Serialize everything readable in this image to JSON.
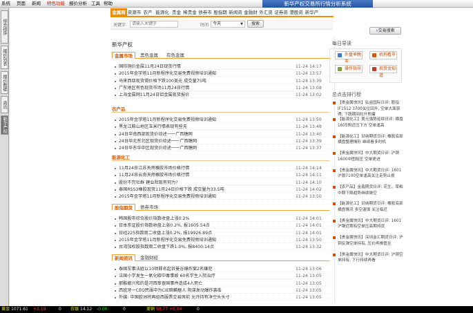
{
  "menu": {
    "items": [
      "系统",
      "页面",
      "新闻",
      "特色功能",
      "报价分析",
      "工具",
      "帮助"
    ],
    "active_index": 3
  },
  "app_title": "新华产权交易所行情分析系统",
  "sidebar": {
    "tabs": [
      "综合排序",
      "报价列表",
      "报价数据",
      "资讯",
      "新华产权"
    ],
    "active_index": 4
  },
  "tabs": [
    "金属商讯",
    "资源市场",
    "农产品",
    "能源化工",
    "贵金属",
    "稀贵金属",
    "债券市场",
    "股指期货",
    "新闻资讯",
    "金融财经",
    "外汇资讯",
    "证券资讯",
    "港股资讯",
    "新华产权"
  ],
  "tabs_active_index": 0,
  "search": {
    "keyword_label": "关键字",
    "keyword_placeholder": "请输入关键字",
    "time_label": "时间",
    "time_value": "今天",
    "search_button": "搜索",
    "trade_search_button": "交易搜索"
  },
  "page_title": "新华产权",
  "sections": [
    {
      "tabs": [
        "金属市场",
        "黑色金属",
        "有色金属"
      ],
      "active": 0,
      "items": [
        {
          "t": "国际铜价金属11月24日现货行情",
          "d": "11-24 14:17"
        },
        {
          "t": "2015年金字塔11月新程序化交易免费视频培训通知",
          "d": "11-24 13:57"
        },
        {
          "t": "马来西亚现货锡价格下跌100美元 成交量75吨",
          "d": "11-24 13:39"
        },
        {
          "t": "广东地区有色现货市场11月24日行情",
          "d": "11-24 13:08"
        },
        {
          "t": "上海金属网11月24日铝金属现货报价",
          "d": "11-24 13:02"
        }
      ]
    },
    {
      "head": "农产品",
      "items": [
        {
          "t": "2015年金字塔11月新程序化交易免费视频培训通知",
          "d": "11-24 13:50"
        },
        {
          "t": "黑龙江鞍山地区玉米行情表现有些无",
          "d": "11-24 13:48"
        },
        {
          "t": "24日华南西部现货价综述一一广西糖网",
          "d": "11-24 13:40"
        },
        {
          "t": "24日华北东北区现货价综述一一广西糖网",
          "d": "11-24 13:39"
        },
        {
          "t": "24日华东华中区现货价综述一一广西糖网",
          "d": "11-24 13:37"
        }
      ]
    },
    {
      "head": "能源化工",
      "items": [
        {
          "t": "11月24日江苏天然橡胶市场价格行情",
          "d": "11-24 14:14"
        },
        {
          "t": "11月24日云南天然橡胶市场价格行情",
          "d": "11-24 14:11"
        },
        {
          "t": "股份不完社群 建业险现有何为?",
          "d": "11-24 14:10"
        },
        {
          "t": "泰国RSS3橡胶现货11月24日价格下跌 成交量为33.5吨",
          "d": "11-24 14:02"
        },
        {
          "t": "2015年金字塔11月新程序化交易免费视频培训通知",
          "d": "11-24 13:50"
        }
      ]
    },
    {
      "tabs": [
        "股指期货",
        "债券市场"
      ],
      "active": 0,
      "items": [
        {
          "t": "韩国股市综合股价指数收盘上涨0.2%",
          "d": "11-24 14:01"
        },
        {
          "t": "日本东证股价指数收盘上涨0.2%, 报1605.54点",
          "d": "11-24 14:01"
        },
        {
          "t": "日经225指数周二收盘上涨0.2%, 报19926.89点",
          "d": "11-24 14:01"
        },
        {
          "t": "2015年金字塔11月新程序化交易免费视频培训通知",
          "d": "11-24 13:50"
        },
        {
          "t": "台湾加权股指数周二收盘下跌1.0%, 报8400.14点",
          "d": "11-24 13:32"
        }
      ]
    },
    {
      "tabs": [
        "新闻资讯",
        "金融财经"
      ],
      "active": 0,
      "items": [
        {
          "t": "泰国军事法庭以10项罪名起诉曼谷爆炸案2名嫌犯",
          "d": "11-24 13:06"
        },
        {
          "t": "法国小学发生一氧化碳中毒事故 60名学生入院治疗",
          "d": "11-24 13:05"
        },
        {
          "t": "那酷撤兴和的是河西审查国事件造成4人死亡",
          "d": "11-24 13:05"
        },
        {
          "t": "西班牙一CEO民服中为CIE暗麟据人 阴谋发动爆炸袭击",
          "d": "11-24 13:05"
        },
        {
          "t": "外媒: 中国欧洲将再组西服票交易席前 允许持有净空头头寸",
          "d": "11-24 13:05"
        }
      ]
    }
  ],
  "right_panel": {
    "title": "每日导读",
    "buttons": [
      {
        "label": "外盘早晚市",
        "color": "#3a7bd5"
      },
      {
        "label": "机构看市",
        "color": "#d85a00"
      },
      {
        "label": "操作指导",
        "color": "#7a9f35"
      },
      {
        "label": "现货金知道",
        "color": "#c23a2a"
      }
    ]
  },
  "rank": {
    "title": "总点击排行榜",
    "items": [
      "【贵金属快讯】弘益国际日评: 股指IF1512 3700关位回升, 空单大面获得; 下跌期间柱升附着",
      "【能源化工】美元强势延续日评: 横盘1605附近压下方 空单逢高",
      "【能源化工】甘纳期货日评: 橡胶底部横盘整理情形 继续看多时机",
      "【贵金属快讯】中大期货日评: 沪铜1600中图阻压 空单更进",
      "【贵金属快讯】中大期货日评: 1601沪银7100空单逢高关注走势止损",
      "【农产品】金鑫期货日评: 花生、菜粕中期下降趋势继续做空",
      "【能源化工】甘纳期货日评: 橡胶底部横盘情况 多空谨慎 关注临近",
      "【贵金属快讯】中大期货日评: 1601沪镍近期有空单压高期持货",
      "【贵金属快讯】深圳金汇期货日评: 沪铜反弹空单持有, 压价再推管至",
      "【贵金属快讯】中大期货日评: 沪铜空单持有; 下行持续再看"
    ]
  },
  "statusbar": [
    {
      "label": "黄金",
      "value": "1071.61",
      "color": "#e0e0e0"
    },
    {
      "label": "",
      "value": "+2.19",
      "color": "#ff3b3b"
    },
    {
      "label": "",
      "value": "0",
      "color": "#e0e0e0"
    },
    {
      "label": "白银",
      "value": "14.12",
      "color": "#e0e0e0"
    },
    {
      "label": "",
      "value": "-0.00",
      "color": "#27d827"
    },
    {
      "label": "",
      "value": "0",
      "color": "#e0e0e0"
    },
    {
      "label": "美铜",
      "value": "98.77",
      "color": "#ff3b3b"
    },
    {
      "label": "",
      "value": "+0.04",
      "color": "#ff3b3b"
    },
    {
      "label": "",
      "value": "0",
      "color": "#e0e0e0"
    }
  ]
}
